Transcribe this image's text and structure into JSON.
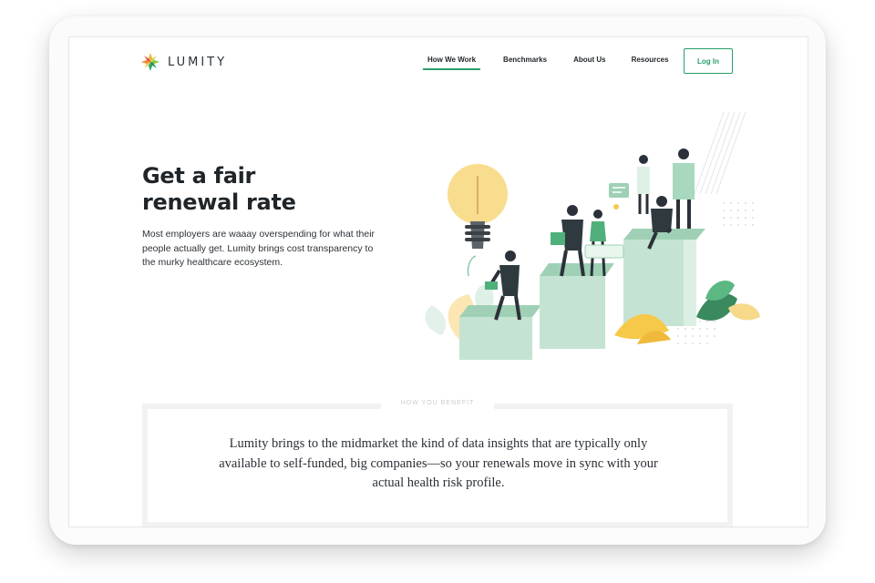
{
  "brand": {
    "name": "LUMITY"
  },
  "nav": {
    "items": [
      {
        "label": "How We Work",
        "active": true
      },
      {
        "label": "Benchmarks",
        "active": false
      },
      {
        "label": "About Us",
        "active": false
      },
      {
        "label": "Resources",
        "active": false
      }
    ],
    "login_label": "Log In"
  },
  "hero": {
    "title_line1": "Get a fair",
    "title_line2": "renewal rate",
    "body": "Most employers are waaay overspending for what their people actually get. Lumity brings cost transparency to the murky healthcare ecosystem."
  },
  "benefit": {
    "label": "HOW YOU BENEFIT",
    "text": "Lumity brings to the midmarket the kind of data insights that are typically only available to self-funded, big companies—so your renewals move in sync with your actual health risk profile."
  },
  "colors": {
    "accent": "#28a06a",
    "text_dark": "#1f2529",
    "block_green": "#cfe8da",
    "bulb_yellow": "#f9dd8f"
  },
  "icons": [
    "lumity-star-logo-icon",
    "hero-illustration"
  ]
}
